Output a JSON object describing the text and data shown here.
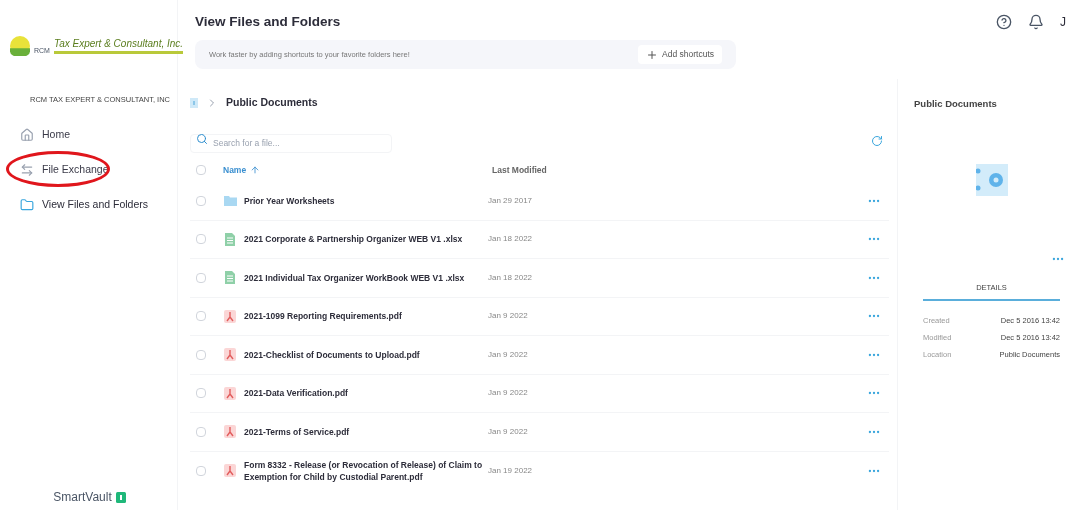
{
  "sidebar": {
    "logo": {
      "initials": "RCM",
      "text": "Tax Expert & Consultant, Inc."
    },
    "company": "RCM TAX EXPERT & CONSULTANT, INC",
    "items": [
      {
        "label": "Home",
        "kind": "home",
        "selected": false,
        "circled": false
      },
      {
        "label": "File Exchange",
        "kind": "exchange",
        "selected": false,
        "circled": true
      },
      {
        "label": "View Files and Folders",
        "kind": "folder",
        "selected": true,
        "circled": false
      }
    ],
    "footer": "SmartVault"
  },
  "header": {
    "title": "View Files and Folders",
    "user": "J"
  },
  "shortcuts": {
    "text": "Work faster by adding shortcuts to your favorite folders here!",
    "button": "Add shortcuts"
  },
  "breadcrumb": {
    "current": "Public Documents"
  },
  "search": {
    "placeholder": "Search for a file..."
  },
  "table": {
    "select_all_checked": false,
    "columns": [
      {
        "label": "Name",
        "sorted": true
      },
      {
        "label": "Last Modified",
        "sorted": false
      }
    ],
    "rows": [
      {
        "kind": "folder",
        "name": "Prior Year Worksheets",
        "modified": "Jan 29 2017",
        "checked": false
      },
      {
        "kind": "xlsx",
        "name": "2021 Corporate & Partnership Organizer WEB V1 .xlsx",
        "modified": "Jan 18 2022",
        "checked": false
      },
      {
        "kind": "xlsx",
        "name": "2021 Individual Tax Organizer WorkBook WEB V1 .xlsx",
        "modified": "Jan 18 2022",
        "checked": false
      },
      {
        "kind": "pdf",
        "name": "2021-1099 Reporting Requirements.pdf",
        "modified": "Jan 9 2022",
        "checked": false
      },
      {
        "kind": "pdf",
        "name": "2021-Checklist of Documents to Upload.pdf",
        "modified": "Jan 9 2022",
        "checked": false
      },
      {
        "kind": "pdf",
        "name": "2021-Data Verification.pdf",
        "modified": "Jan 9 2022",
        "checked": false
      },
      {
        "kind": "pdf",
        "name": "2021-Terms of Service.pdf",
        "modified": "Jan 9 2022",
        "checked": false
      },
      {
        "kind": "pdf",
        "name": "Form 8332 - Release (or Revocation of Release) of Claim to Exemption for Child by Custodial Parent.pdf",
        "modified": "Jan 19 2022",
        "checked": false
      }
    ]
  },
  "details_panel": {
    "title": "Public Documents",
    "tab": "DETAILS",
    "fields": [
      {
        "label": "Created",
        "value": "Dec 5 2016 13:42"
      },
      {
        "label": "Modified",
        "value": "Dec 5 2016 13:42"
      },
      {
        "label": "Location",
        "value": "Public Documents"
      }
    ]
  }
}
